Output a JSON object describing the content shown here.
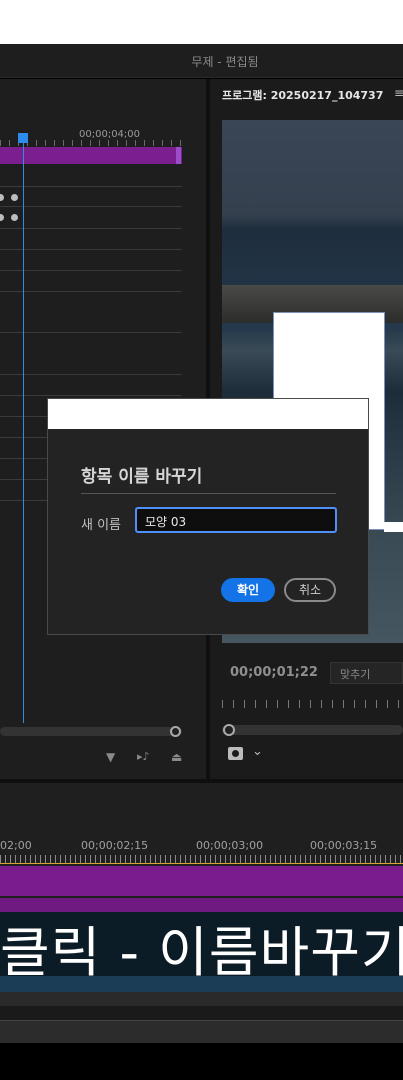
{
  "window": {
    "title": "무제 - 편집됨"
  },
  "effect_controls": {
    "timecode": "00;00;04;00",
    "tools": [
      "filter-icon",
      "play-audio-icon",
      "export-icon"
    ]
  },
  "program_monitor": {
    "title": "프로그램: 20250217_104737",
    "menu_icon": "≡",
    "timecode": "00;00;01;22",
    "fit_label": "맞추기",
    "dropdown_glyph": "⌄"
  },
  "timeline": {
    "ruler_labels": [
      "02;00",
      "00;00;02;15",
      "00;00;03;00",
      "00;00;03;15"
    ],
    "caption_text": "클릭 - 이름바꾸기"
  },
  "dialog": {
    "title": "항목 이름 바꾸기",
    "name_label": "새 이름",
    "name_value": "모양 03",
    "ok_label": "확인",
    "cancel_label": "취소"
  },
  "colors": {
    "accent": "#1473e6",
    "playhead": "#2d8ceb",
    "clip_purple": "#7a1c8c",
    "panel_bg": "#1e1e1e"
  }
}
